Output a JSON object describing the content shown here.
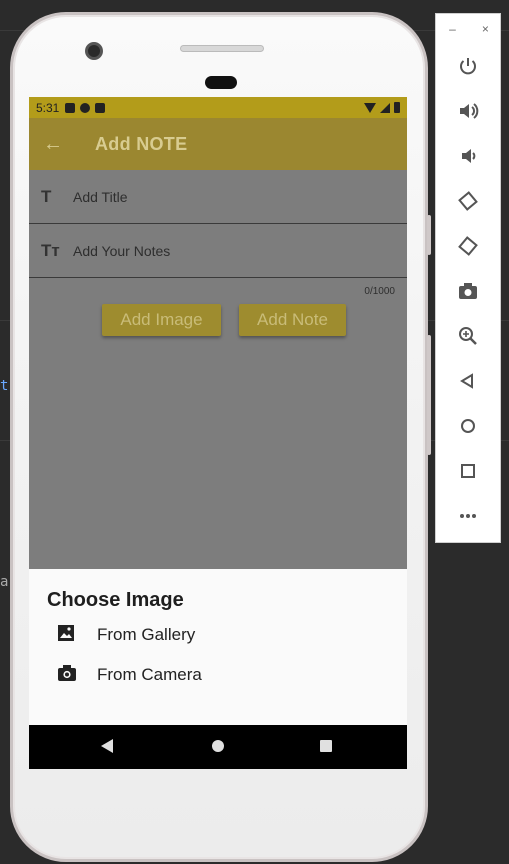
{
  "status_bar": {
    "time": "5:31"
  },
  "app_bar": {
    "title": "Add NOTE",
    "back_icon": "arrow-left-icon"
  },
  "form": {
    "title_placeholder": "Add Title",
    "notes_placeholder": "Add Your Notes",
    "counter": "0/1000",
    "buttons": {
      "add_image": "Add Image",
      "add_note": "Add Note"
    }
  },
  "bottom_sheet": {
    "title": "Choose Image",
    "items": [
      {
        "label": "From Gallery",
        "icon": "image-icon"
      },
      {
        "label": "From Camera",
        "icon": "camera-icon"
      }
    ]
  },
  "emulator_toolbar": {
    "window_controls": [
      "–",
      "×"
    ],
    "tools": [
      "power",
      "volume-up",
      "volume-down",
      "rotate-left",
      "rotate-right",
      "screenshot",
      "zoom",
      "back",
      "home",
      "overview",
      "more"
    ]
  },
  "colors": {
    "accent": "#9b8730",
    "scrim": "#7d7d7d",
    "sheet_bg": "#fafafa",
    "nav_bg": "#000000",
    "toolbar_icons": "#555555"
  }
}
